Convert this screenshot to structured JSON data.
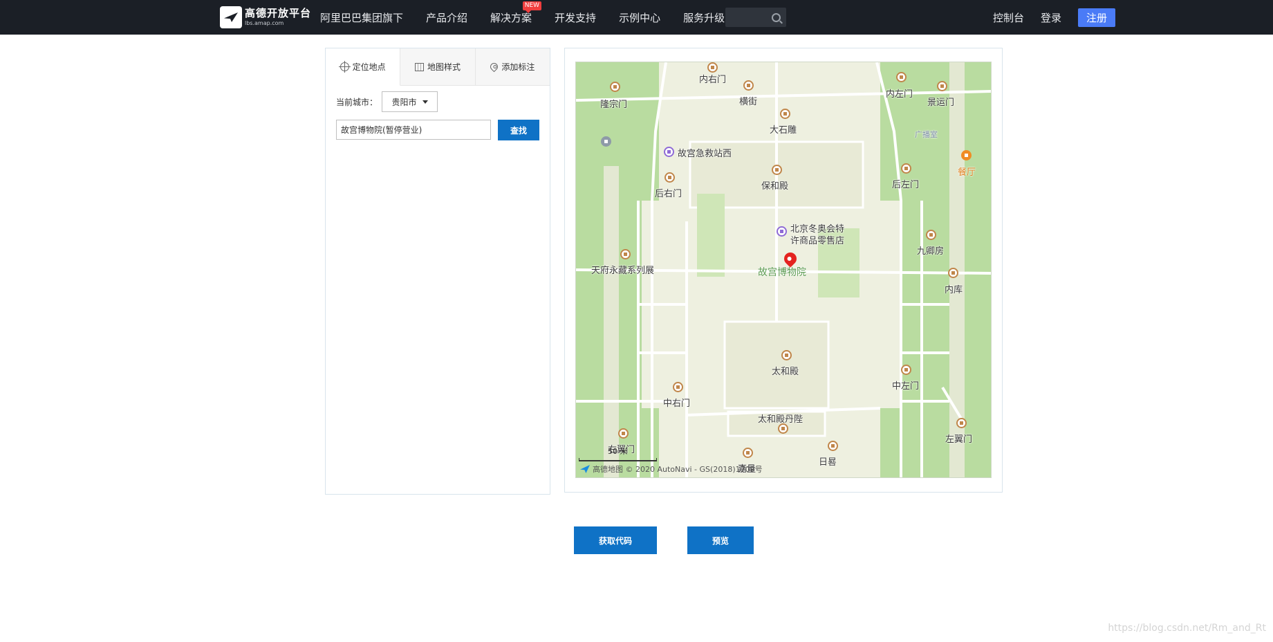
{
  "header": {
    "logo_title": "高德开放平台",
    "logo_domain": "lbs.amap.com",
    "nav": [
      {
        "label": "阿里巴巴集团旗下"
      },
      {
        "label": "产品介绍"
      },
      {
        "label": "解决方案",
        "badge": "NEW"
      },
      {
        "label": "开发支持"
      },
      {
        "label": "示例中心"
      },
      {
        "label": "服务升级"
      }
    ],
    "search_placeholder": "",
    "console": "控制台",
    "login": "登录",
    "register": "注册"
  },
  "panel": {
    "tabs": [
      {
        "label": "定位地点",
        "icon": "locate-icon",
        "active": true
      },
      {
        "label": "地图样式",
        "icon": "map-icon"
      },
      {
        "label": "添加标注",
        "icon": "pin-icon"
      }
    ],
    "city_label": "当前城市：",
    "city_value": "贵阳市",
    "search_value": "故宫博物院(暂停营业)",
    "find_button": "查找"
  },
  "map": {
    "marker_label": "故宫博物院",
    "pois": [
      {
        "name": "内右门"
      },
      {
        "name": "横街"
      },
      {
        "name": "内左门"
      },
      {
        "name": "景运门"
      },
      {
        "name": "隆宗门"
      },
      {
        "name": "大石雕"
      },
      {
        "name": "广播室"
      },
      {
        "name": "故宫急救站西"
      },
      {
        "name": "餐厅"
      },
      {
        "name": "保和殿"
      },
      {
        "name": "后右门"
      },
      {
        "name": "后左门"
      },
      {
        "name": "北京冬奥会特"
      },
      {
        "name": "许商品零售店"
      },
      {
        "name": "九卿房"
      },
      {
        "name": "天府永藏系列展"
      },
      {
        "name": "内库"
      },
      {
        "name": "太和殿"
      },
      {
        "name": "中左门"
      },
      {
        "name": "中右门"
      },
      {
        "name": "太和殿丹陛"
      },
      {
        "name": "左翼门"
      },
      {
        "name": "右翼门"
      },
      {
        "name": "日晷"
      },
      {
        "name": "嘉量"
      }
    ],
    "scale": "50 米",
    "attribution": "高德地图 © 2020 AutoNavi - GS(2018)1709号"
  },
  "actions": {
    "get_code": "获取代码",
    "preview": "预览"
  },
  "watermark": "https://blog.csdn.net/Rm_and_Rt",
  "colors": {
    "topbar": "#1b1f26",
    "primary": "#0f72c6",
    "register": "#4a7bf7",
    "map_green": "#b9dca0",
    "map_palace": "#eef0e0",
    "marker": "#e4231f"
  }
}
